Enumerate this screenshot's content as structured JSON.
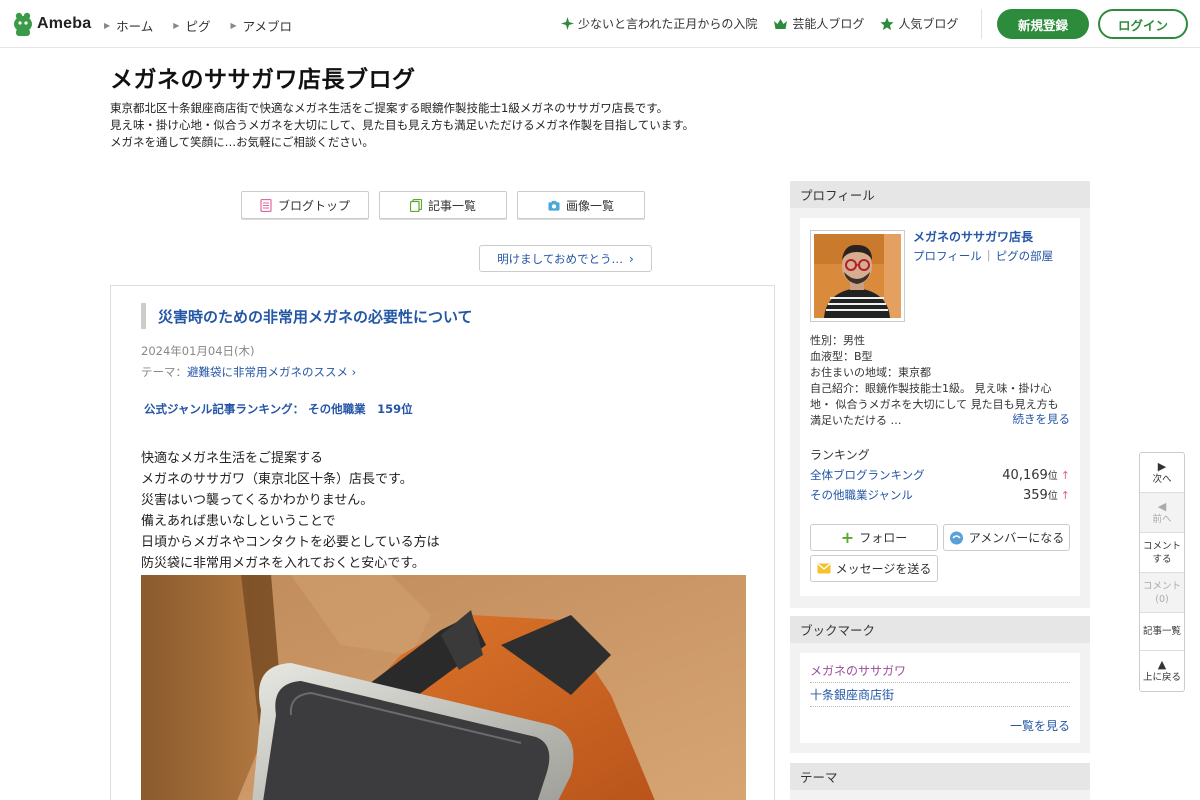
{
  "header": {
    "logo_text": "Ameba",
    "nav": [
      "ホーム",
      "ピグ",
      "アメブロ"
    ],
    "topics": [
      {
        "label": "少ないと言われた正月からの入院",
        "icon": "sparkle-icon"
      },
      {
        "label": "芸能人ブログ",
        "icon": "crown-icon"
      },
      {
        "label": "人気ブログ",
        "icon": "star-icon"
      }
    ],
    "register_label": "新規登録",
    "login_label": "ログイン",
    "accent": "#2d8c3c"
  },
  "blog": {
    "title": "メガネのササガワ店長ブログ",
    "description": [
      "東京都北区十条銀座商店街で快適なメガネ生活をご提案する眼鏡作製技能士1級メガネのササガワ店長です。",
      "見え味・掛け心地・似合うメガネを大切にして、見た目も見え方も満足いただけるメガネ作製を目指しています。",
      "メガネを通して笑顔に…お気軽にご相談ください。"
    ],
    "nav": {
      "top": "ブログトップ",
      "articles": "記事一覧",
      "images": "画像一覧"
    },
    "recent_article": "明けましておめでとう…"
  },
  "article": {
    "title": "災害時のための非常用メガネの必要性について",
    "date": "2024年01月04日(木)",
    "theme_label": "テーマ：",
    "theme_value": "避難袋に非常用メガネのススメ",
    "ranking": "公式ジャンル記事ランキング： その他職業　159位",
    "body": [
      "快適なメガネ生活をご提案する",
      "メガネのササガワ（東京北区十条）店長です。",
      "災害はいつ襲ってくるかわかりません。",
      "備えあれば患いなしということで",
      "日頃からメガネやコンタクトを必要としている方は",
      "防災袋に非常用メガネを入れておくと安心です。"
    ]
  },
  "sidebar": {
    "profile": {
      "heading": "プロフィール",
      "name": "メガネのササガワ店長",
      "link_profile": "プロフィール",
      "link_room": "ピグの部屋",
      "gender": "性別：男性",
      "blood": "血液型：B型",
      "location": "お住まいの地域：東京都",
      "intro_lines": [
        "自己紹介：眼鏡作製技能士1級。 見え味・掛け心",
        "地・ 似合うメガネを大切にして 見た目も見え方も",
        "満足いただける …"
      ],
      "more": "続きを見る",
      "ranking_label": "ランキング",
      "rankings": [
        {
          "name": "全体ブログランキング",
          "value": "40,169",
          "unit": "位"
        },
        {
          "name": "その他職業ジャンル",
          "value": "359",
          "unit": "位"
        }
      ],
      "follow": "フォロー",
      "amember": "アメンバーになる",
      "message": "メッセージを送る"
    },
    "bookmark": {
      "heading": "ブックマーク",
      "links": [
        "メガネのササガワ",
        "十条銀座商店街"
      ],
      "more": "一覧を見る"
    },
    "theme_heading": "テーマ"
  },
  "float_nav": {
    "next": "次へ",
    "prev": "前へ",
    "comment_write": [
      "コメント",
      "する"
    ],
    "comment_count": [
      "コメント",
      "(0)"
    ],
    "list": "記事一覧",
    "top": "上に戻る"
  }
}
